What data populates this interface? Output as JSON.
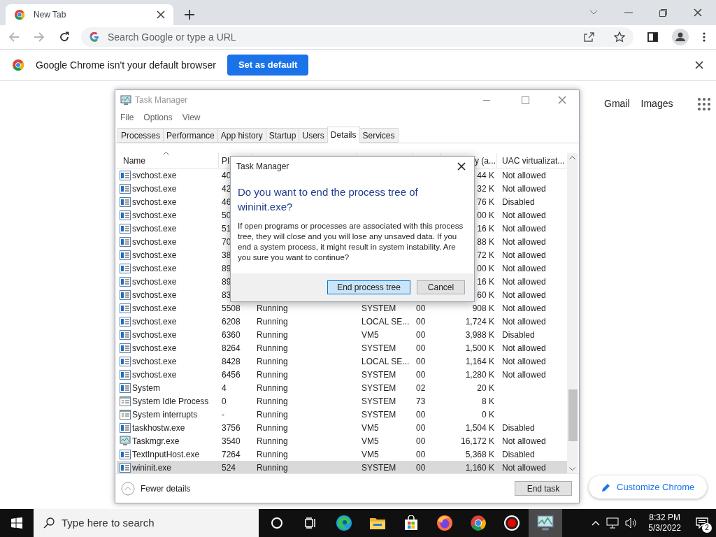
{
  "browser": {
    "tab": {
      "title": "New Tab"
    },
    "omnibox": {
      "placeholder": "Search Google or type a URL"
    },
    "infobar": {
      "message": "Google Chrome isn't your default browser",
      "button": "Set as default"
    },
    "page": {
      "links": [
        "Gmail",
        "Images"
      ],
      "customize_button": "Customize Chrome"
    }
  },
  "task_manager": {
    "window": {
      "title": "Task Manager"
    },
    "menu": [
      "File",
      "Options",
      "View"
    ],
    "tabs": [
      {
        "label": "Processes",
        "selected": false
      },
      {
        "label": "Performance",
        "selected": false
      },
      {
        "label": "App history",
        "selected": false
      },
      {
        "label": "Startup",
        "selected": false
      },
      {
        "label": "Users",
        "selected": false
      },
      {
        "label": "Details",
        "selected": true
      },
      {
        "label": "Services",
        "selected": false
      }
    ],
    "table": {
      "columns": {
        "name": "Name",
        "pid": "PI",
        "memory": "y (a...",
        "uac": "UAC virtualizat..."
      },
      "rows": [
        {
          "kind": "service",
          "selected": false,
          "name": "svchost.exe",
          "pid": "40",
          "memory": "44 K",
          "uac": "Not allowed"
        },
        {
          "kind": "service",
          "selected": false,
          "name": "svchost.exe",
          "pid": "42",
          "memory": "32 K",
          "uac": "Not allowed"
        },
        {
          "kind": "service",
          "selected": false,
          "name": "svchost.exe",
          "pid": "46",
          "memory": "76 K",
          "uac": "Disabled"
        },
        {
          "kind": "service",
          "selected": false,
          "name": "svchost.exe",
          "pid": "50",
          "memory": "00 K",
          "uac": "Not allowed"
        },
        {
          "kind": "service",
          "selected": false,
          "name": "svchost.exe",
          "pid": "51",
          "memory": "16 K",
          "uac": "Not allowed"
        },
        {
          "kind": "service",
          "selected": false,
          "name": "svchost.exe",
          "pid": "70",
          "memory": "88 K",
          "uac": "Not allowed"
        },
        {
          "kind": "service",
          "selected": false,
          "name": "svchost.exe",
          "pid": "38",
          "memory": "72 K",
          "uac": "Not allowed"
        },
        {
          "kind": "service",
          "selected": false,
          "name": "svchost.exe",
          "pid": "89",
          "memory": "00 K",
          "uac": "Not allowed"
        },
        {
          "kind": "service",
          "selected": false,
          "name": "svchost.exe",
          "pid": "89",
          "memory": "16 K",
          "uac": "Not allowed"
        },
        {
          "kind": "service",
          "selected": false,
          "name": "svchost.exe",
          "pid": "83",
          "memory": "60 K",
          "uac": "Not allowed"
        },
        {
          "kind": "service",
          "selected": false,
          "name": "svchost.exe",
          "pid": "5508",
          "status": "Running",
          "user": "SYSTEM",
          "cpu": "00",
          "memory": "908 K",
          "uac": "Not allowed"
        },
        {
          "kind": "service",
          "selected": false,
          "name": "svchost.exe",
          "pid": "6208",
          "status": "Running",
          "user": "LOCAL SE...",
          "cpu": "00",
          "memory": "1,724 K",
          "uac": "Not allowed"
        },
        {
          "kind": "service",
          "selected": false,
          "name": "svchost.exe",
          "pid": "6360",
          "status": "Running",
          "user": "VM5",
          "cpu": "00",
          "memory": "3,988 K",
          "uac": "Disabled"
        },
        {
          "kind": "service",
          "selected": false,
          "name": "svchost.exe",
          "pid": "8264",
          "status": "Running",
          "user": "SYSTEM",
          "cpu": "00",
          "memory": "1,500 K",
          "uac": "Not allowed"
        },
        {
          "kind": "service",
          "selected": false,
          "name": "svchost.exe",
          "pid": "8428",
          "status": "Running",
          "user": "LOCAL SE...",
          "cpu": "00",
          "memory": "1,164 K",
          "uac": "Not allowed"
        },
        {
          "kind": "service",
          "selected": false,
          "name": "svchost.exe",
          "pid": "6456",
          "status": "Running",
          "user": "SYSTEM",
          "cpu": "00",
          "memory": "1,280 K",
          "uac": "Not allowed"
        },
        {
          "kind": "service",
          "selected": false,
          "name": "System",
          "pid": "4",
          "status": "Running",
          "user": "SYSTEM",
          "cpu": "02",
          "memory": "20 K"
        },
        {
          "kind": "window",
          "selected": false,
          "name": "System Idle Process",
          "pid": "0",
          "status": "Running",
          "user": "SYSTEM",
          "cpu": "73",
          "memory": "8 K"
        },
        {
          "kind": "window",
          "selected": false,
          "name": "System interrupts",
          "pid": "-",
          "status": "Running",
          "user": "SYSTEM",
          "cpu": "00",
          "memory": "0 K"
        },
        {
          "kind": "service",
          "selected": false,
          "name": "taskhostw.exe",
          "pid": "3756",
          "status": "Running",
          "user": "VM5",
          "cpu": "00",
          "memory": "1,504 K",
          "uac": "Disabled"
        },
        {
          "kind": "monitor",
          "selected": false,
          "name": "Taskmgr.exe",
          "pid": "3540",
          "status": "Running",
          "user": "VM5",
          "cpu": "00",
          "memory": "16,172 K",
          "uac": "Not allowed"
        },
        {
          "kind": "service",
          "selected": false,
          "name": "TextInputHost.exe",
          "pid": "7264",
          "status": "Running",
          "user": "VM5",
          "cpu": "00",
          "memory": "5,368 K",
          "uac": "Disabled"
        },
        {
          "kind": "service",
          "selected": true,
          "name": "wininit.exe",
          "pid": "524",
          "status": "Running",
          "user": "SYSTEM",
          "cpu": "00",
          "memory": "1,160 K",
          "uac": "Not allowed"
        }
      ]
    },
    "footer": {
      "fewer_details": "Fewer details",
      "end_task": "End task"
    }
  },
  "dialog": {
    "title": "Task Manager",
    "heading": "Do you want to end the process tree of wininit.exe?",
    "message": "If open programs or processes are associated with this process tree, they will close and you will lose any unsaved data. If you end a system process, it might result in system instability. Are you sure you want to continue?",
    "buttons": [
      {
        "label": "End process tree",
        "default": true
      },
      {
        "label": "Cancel",
        "default": false
      }
    ]
  },
  "taskbar": {
    "search_placeholder": "Type here to search",
    "apps": [
      {
        "kind": "cortana",
        "active": false
      },
      {
        "kind": "taskview",
        "active": false
      },
      {
        "kind": "edge",
        "active": false
      },
      {
        "kind": "folder",
        "active": false
      },
      {
        "kind": "store",
        "active": false
      },
      {
        "kind": "firefox",
        "active": false
      },
      {
        "kind": "chrome",
        "active": false
      },
      {
        "kind": "record",
        "active": false
      },
      {
        "kind": "monitor",
        "active": true
      }
    ],
    "time": "8:32 PM",
    "date": "5/3/2022",
    "notifications": "2"
  }
}
